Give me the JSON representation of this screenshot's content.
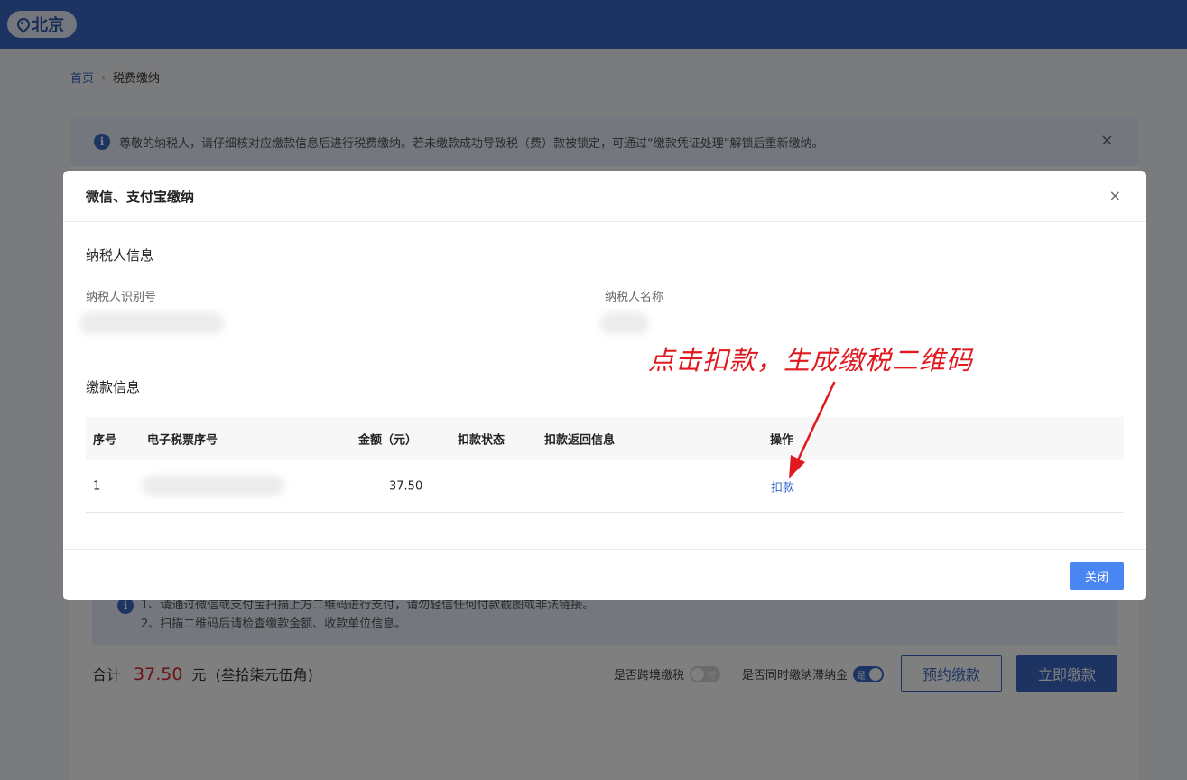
{
  "header": {
    "city": "北京",
    "city_icon": "location-pin-icon"
  },
  "breadcrumb": {
    "home": "首页",
    "separator": "›",
    "current": "税费缴纳"
  },
  "notice": {
    "text": "尊敬的纳税人，请仔细核对应缴款信息后进行税费缴纳。若未缴款成功导致税（费）款被锁定，可通过“缴款凭证处理”解锁后重新缴纳。",
    "close": "×"
  },
  "tips": {
    "line1": "1、请通过微信或支付宝扫描上方二维码进行支付，请勿轻信任何付款截图或非法链接。",
    "line2": "2、扫描二维码后请检查缴款金额、收款单位信息。"
  },
  "summary": {
    "total_label": "合计",
    "total_amount": "37.50",
    "unit": "元",
    "amount_words": "(叁拾柒元伍角)",
    "cross_border_label": "是否跨境缴税",
    "cross_border_state": "否",
    "late_fee_label": "是否同时缴纳滞纳金",
    "late_fee_state": "是",
    "reserve_button": "预约缴款",
    "pay_now_button": "立即缴款"
  },
  "modal": {
    "title": "微信、支付宝缴纳",
    "close": "×",
    "taxpayer_section": "纳税人信息",
    "taxpayer_id_label": "纳税人识别号",
    "taxpayer_name_label": "纳税人名称",
    "payment_section": "缴款信息",
    "table": {
      "headers": [
        "序号",
        "电子税票序号",
        "金额（元）",
        "扣款状态",
        "扣款返回信息",
        "操作"
      ],
      "rows": [
        {
          "index": "1",
          "amount": "37.50",
          "status": "",
          "message": "",
          "action": "扣款"
        }
      ]
    },
    "close_button": "关闭"
  },
  "annotation": {
    "text": "点击扣款，生成缴税二维码",
    "color": "#e0191f"
  },
  "colors": {
    "primary": "#3a68c7",
    "button": "#4a86f2",
    "amount_red": "#d9262a"
  }
}
